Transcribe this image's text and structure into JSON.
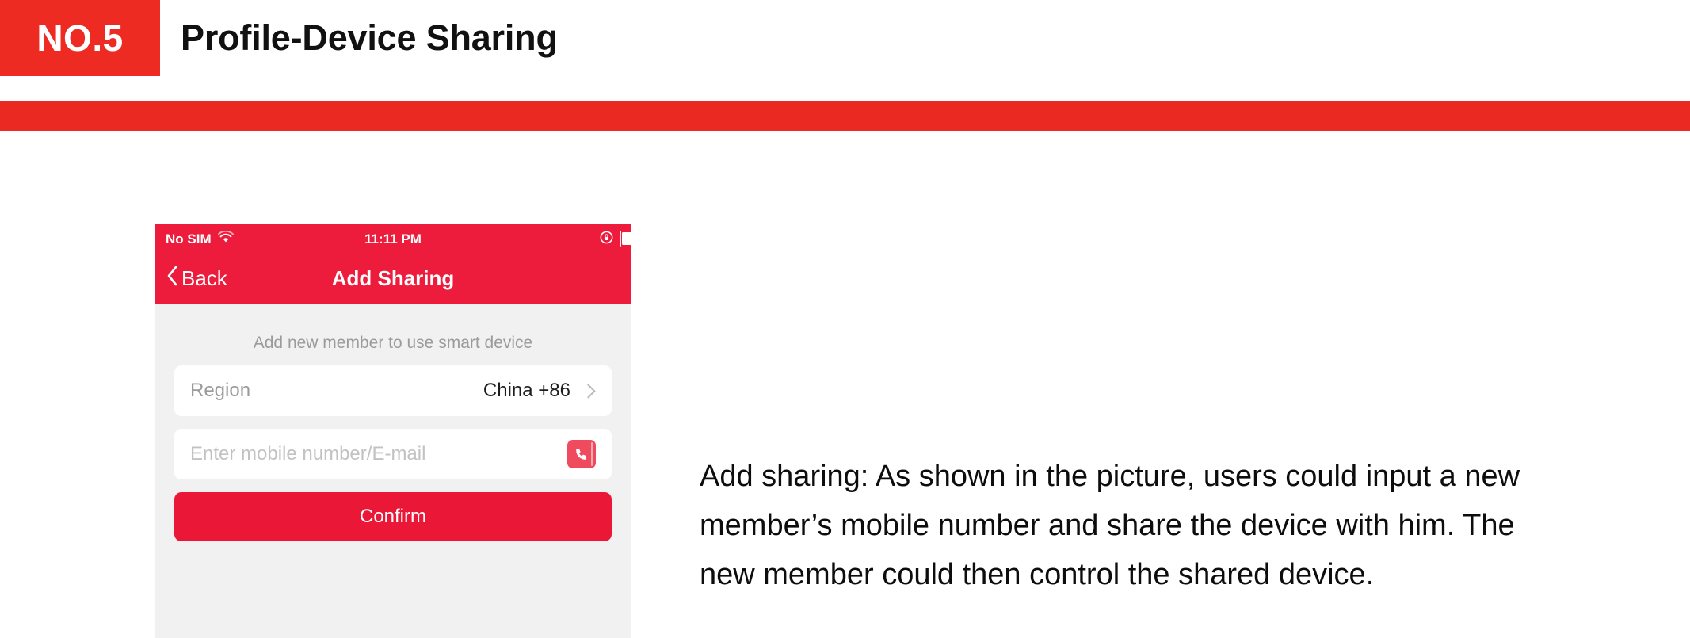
{
  "slide": {
    "badge_label": "NO.5",
    "title": "Profile-Device Sharing",
    "badge_color": "#ee2b22",
    "rule_color": "#ea2a22"
  },
  "phone": {
    "status_bar": {
      "carrier": "No SIM",
      "wifi_icon": "wifi-icon",
      "time": "11:11 PM",
      "rotation_lock_icon": "rotation-lock-icon",
      "battery_icon": "battery-icon",
      "background_color": "#ee1c3c"
    },
    "nav_bar": {
      "back_icon": "chevron-left-icon",
      "back_label": "Back",
      "title": "Add Sharing",
      "background_color": "#ee1c3c"
    },
    "form": {
      "hint": "Add new member to use smart device",
      "region_row": {
        "label": "Region",
        "value": "China +86",
        "chevron_icon": "chevron-right-icon"
      },
      "mobile_row": {
        "value": "",
        "placeholder": "Enter mobile number/E-mail",
        "contacts_icon": "contacts-phone-book-icon",
        "contacts_color": "#f04a5e"
      },
      "confirm_label": "Confirm",
      "confirm_color": "#ea1737"
    }
  },
  "description": {
    "text": "Add sharing: As shown in the picture, users could input a new member’s mobile number and share the device with him. The new member could then control the shared device."
  }
}
